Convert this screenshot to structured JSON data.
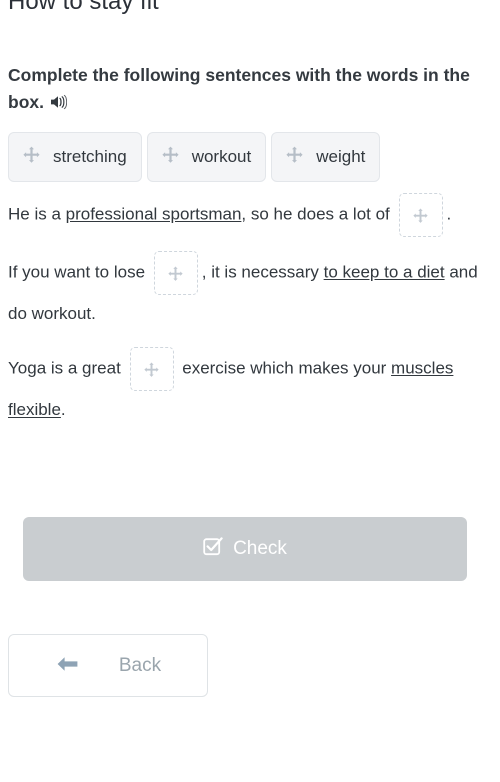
{
  "header": {
    "title": "How to stay fit"
  },
  "instruction": {
    "text": "Complete the following sentences with the words in the box.",
    "audio_icon": "speaker-icon"
  },
  "word_bank": {
    "drag_icon": "move-arrows-icon",
    "items": [
      {
        "label": "stretching"
      },
      {
        "label": "workout"
      },
      {
        "label": "weight"
      }
    ]
  },
  "exercise": {
    "blank_icon": "move-arrows-icon",
    "sentences": [
      {
        "id": "sentence-1",
        "parts": [
          {
            "type": "text",
            "value": "He is a "
          },
          {
            "type": "underline",
            "value": "professional sportsman"
          },
          {
            "type": "text",
            "value": ", so he does a lot of "
          },
          {
            "type": "blank"
          },
          {
            "type": "text",
            "value": "."
          }
        ]
      },
      {
        "id": "sentence-2",
        "parts": [
          {
            "type": "text",
            "value": "If you want to lose "
          },
          {
            "type": "blank"
          },
          {
            "type": "text",
            "value": ", it is necessary "
          },
          {
            "type": "underline",
            "value": "to keep to a diet"
          },
          {
            "type": "text",
            "value": " and do workout."
          }
        ]
      },
      {
        "id": "sentence-3",
        "parts": [
          {
            "type": "text",
            "value": "Yoga is a great "
          },
          {
            "type": "blank"
          },
          {
            "type": "text",
            "value": " exercise which makes your "
          },
          {
            "type": "underline",
            "value": "muscles flexible"
          },
          {
            "type": "text",
            "value": "."
          }
        ]
      }
    ]
  },
  "actions": {
    "check": {
      "label": "Check",
      "icon": "checkbox-checked-icon",
      "disabled": true,
      "background": "#c9cdd0",
      "text_color": "#ffffff"
    },
    "back": {
      "label": "Back",
      "icon": "arrow-left-icon",
      "text_color": "#9aa5ad",
      "border_color": "#dfe3e6"
    }
  },
  "colors": {
    "page_background": "#ffffff",
    "body_text": "#32383e",
    "heading_text": "#343a40",
    "chip_background": "#f4f5f7",
    "chip_border": "#e3e6ea",
    "blank_border": "#cfd6dd",
    "icon_muted": "#adb5bd"
  }
}
